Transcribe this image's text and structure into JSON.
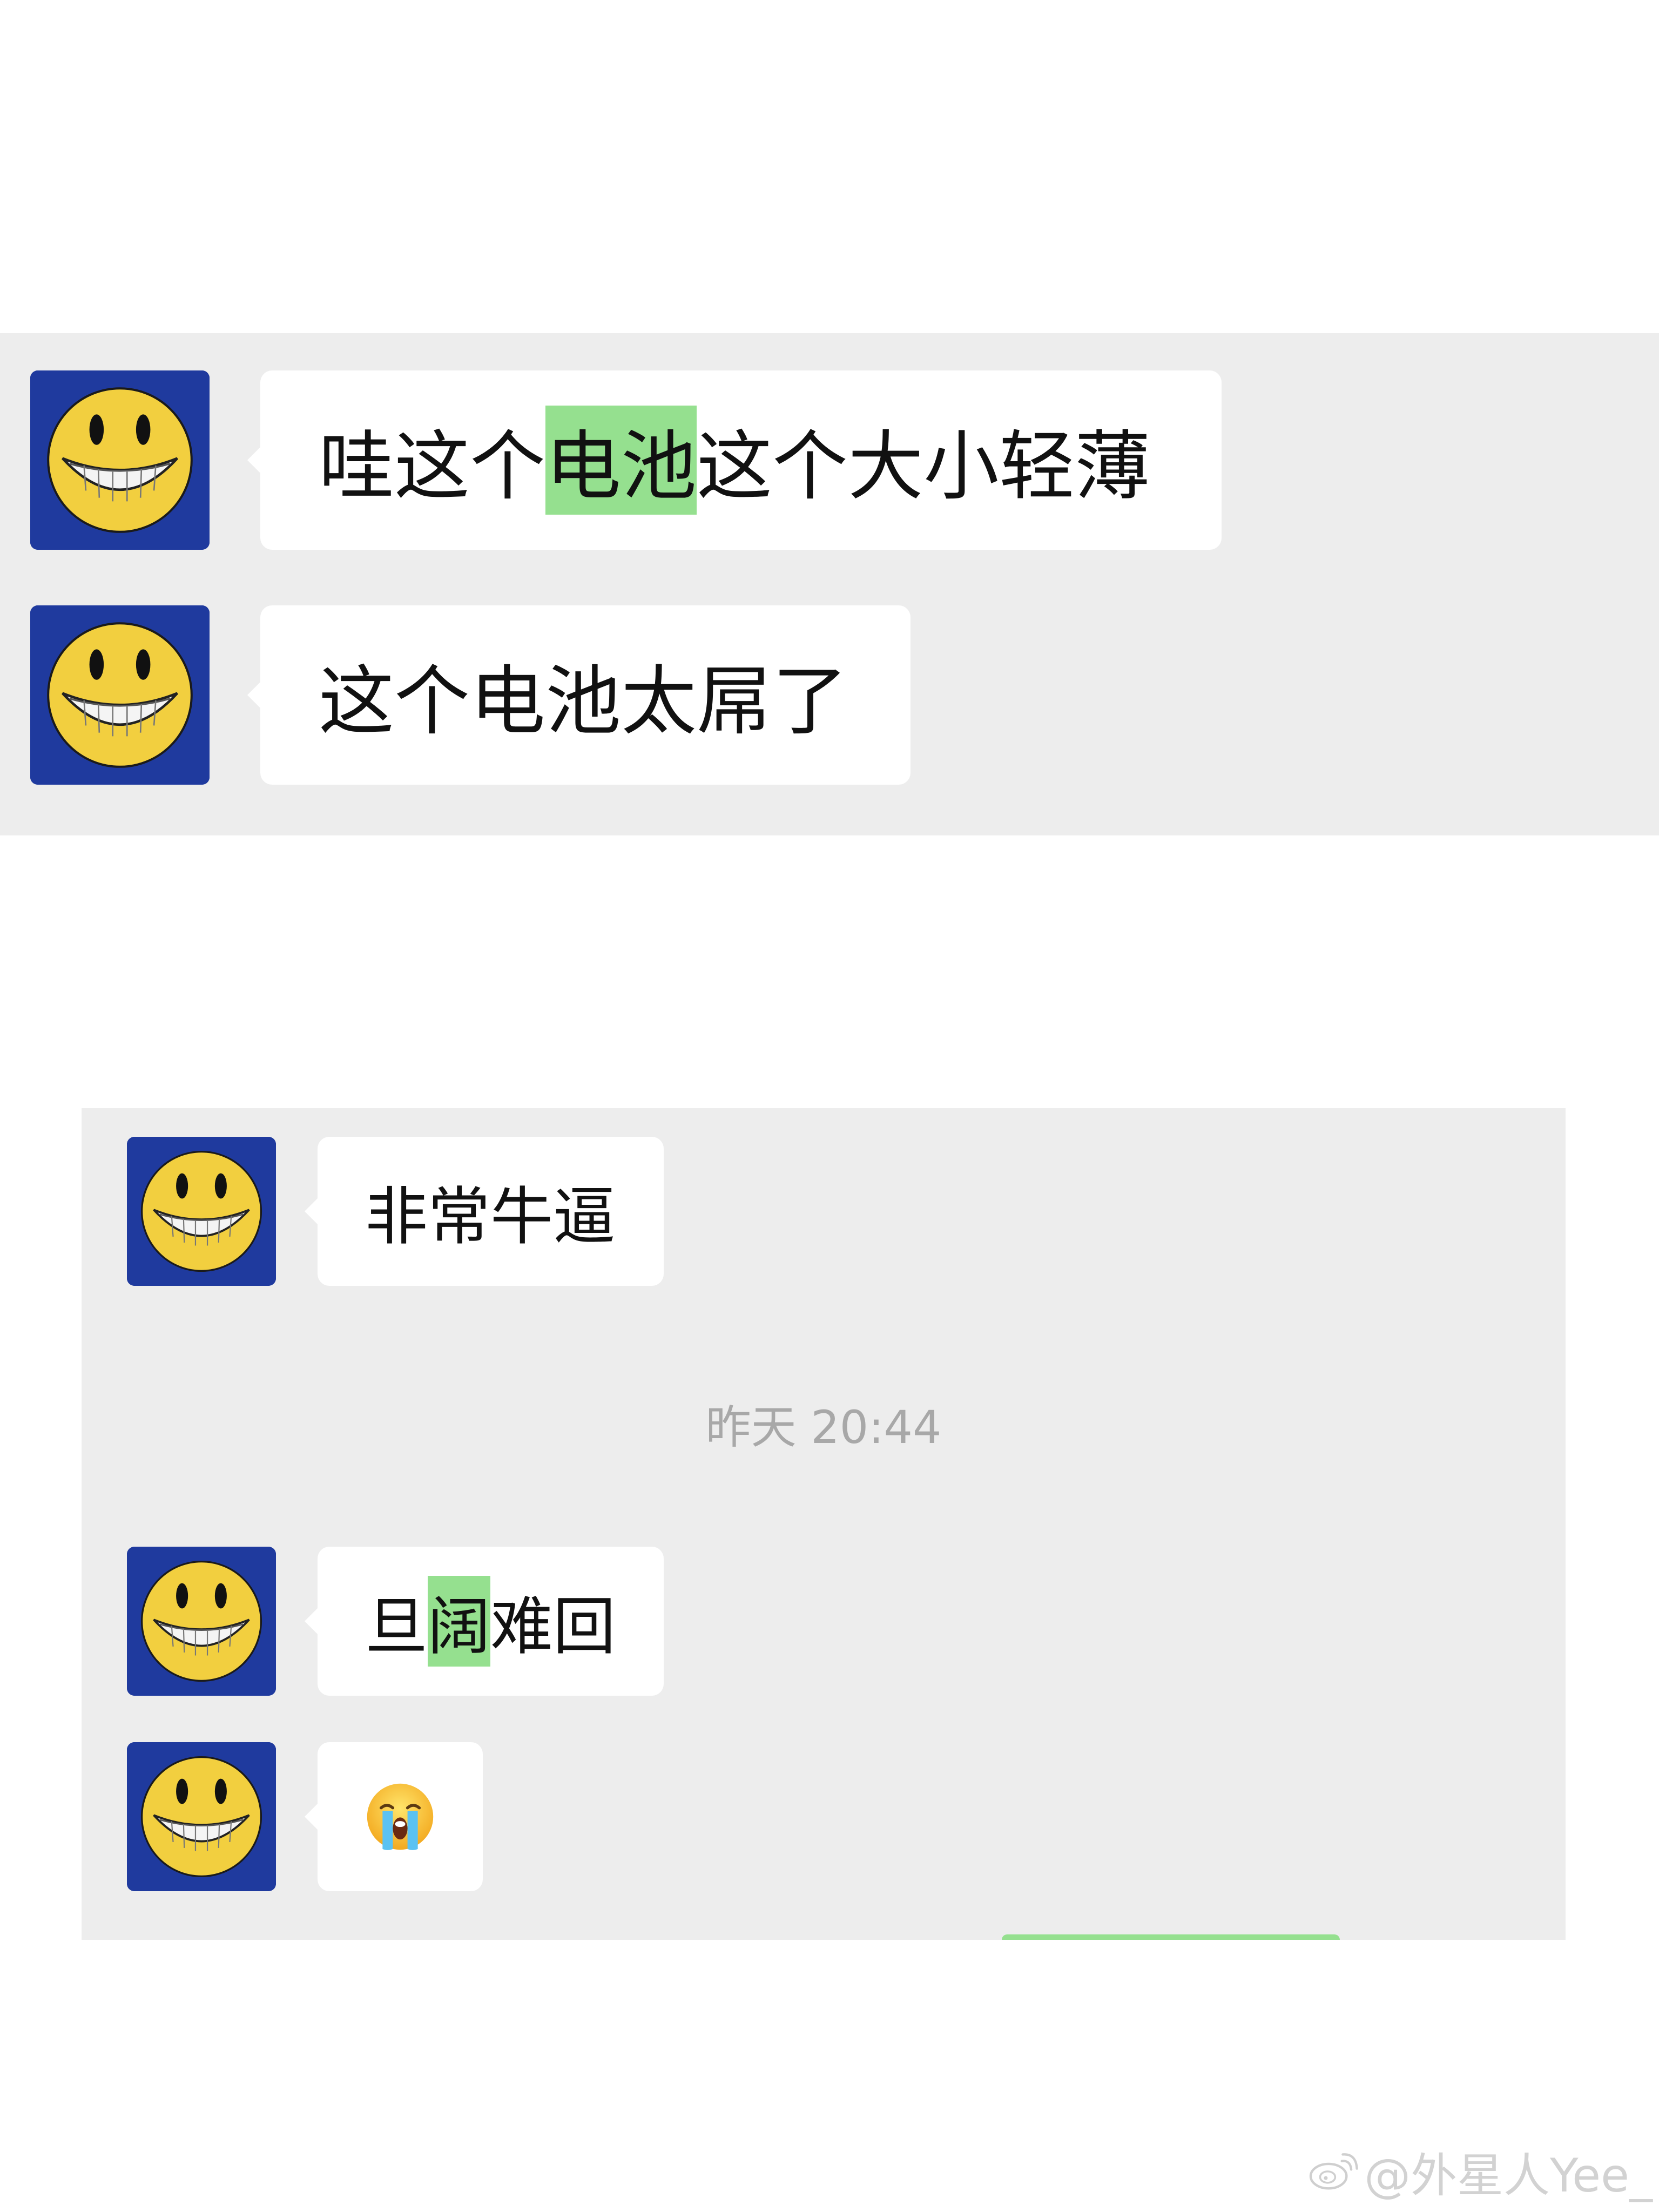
{
  "colors": {
    "panel_bg": "#ededed",
    "bubble_bg": "#ffffff",
    "highlight": "#95e08f",
    "avatar_bg": "#1f3a9e",
    "smiley_yellow": "#f2cf3f",
    "timestamp_text": "#a8a8a8",
    "watermark_text": "#d2d2d2"
  },
  "top_section": {
    "messages": [
      {
        "avatar": "grinning-smiley-avatar",
        "text_before": "哇这个",
        "highlight": "电池",
        "text_after": "这个大小轻薄"
      },
      {
        "avatar": "grinning-smiley-avatar",
        "text": "这个电池太屌了"
      }
    ]
  },
  "bottom_section": {
    "messages": [
      {
        "avatar": "grinning-smiley-avatar",
        "text": "非常牛逼"
      },
      {
        "avatar": "grinning-smiley-avatar",
        "text_before": "旦",
        "highlight": "阔",
        "text_after": "难回"
      },
      {
        "avatar": "grinning-smiley-avatar",
        "emoji": "loudly-crying-face-icon"
      }
    ],
    "timestamp": "昨天 20:44"
  },
  "watermark": {
    "icon": "weibo-logo-icon",
    "text": "@外星人Yee_"
  }
}
